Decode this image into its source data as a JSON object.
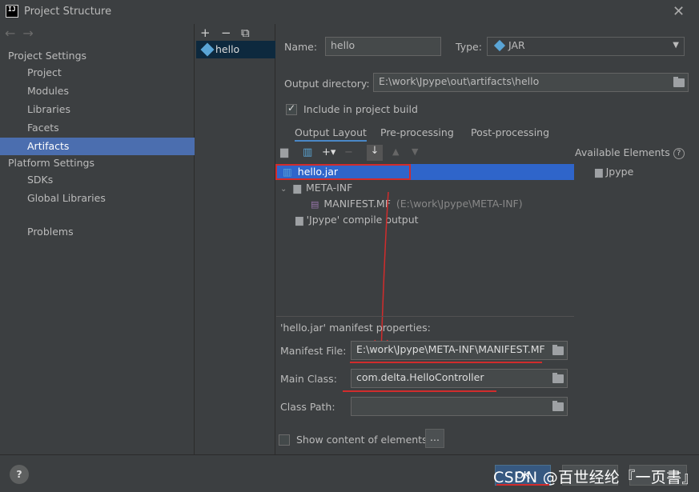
{
  "window": {
    "title": "Project Structure",
    "logo": "IJ"
  },
  "nav": {
    "back": "←",
    "forward": "→"
  },
  "sidebar": {
    "section1": "Project Settings",
    "items1": [
      "Project",
      "Modules",
      "Libraries",
      "Facets",
      "Artifacts"
    ],
    "section2": "Platform Settings",
    "items2": [
      "SDKs",
      "Global Libraries"
    ],
    "problems": "Problems",
    "selected": "Artifacts"
  },
  "artifacts": {
    "toolbar": [
      "+",
      "−",
      "⧉"
    ],
    "list": [
      "hello"
    ]
  },
  "form": {
    "name_label": "Name:",
    "name_value": "hello",
    "type_label": "Type:",
    "type_value": "JAR",
    "output_label": "Output directory:",
    "output_value": "E:\\work\\Jpype\\out\\artifacts\\hello",
    "include_label": "Include in project build",
    "include_checked": true
  },
  "tabs": [
    "Output Layout",
    "Pre-processing",
    "Post-processing"
  ],
  "tree": {
    "root": "hello.jar",
    "meta": "META-INF",
    "manifest": "MANIFEST.MF",
    "manifest_path": "(E:\\work\\Jpype\\META-INF)",
    "compile": "'Jpype' compile output"
  },
  "available": {
    "label": "Available Elements",
    "items": [
      "Jpype"
    ]
  },
  "manifest": {
    "heading": "'hello.jar' manifest properties:",
    "file_label": "Manifest File:",
    "file_value": "E:\\work\\Jpype\\META-INF\\MANIFEST.MF",
    "class_label": "Main Class:",
    "class_value": "com.delta.HelloController",
    "classpath_label": "Class Path:",
    "classpath_value": ""
  },
  "show_content": {
    "label": "Show content of elements",
    "button": "..."
  },
  "footer": {
    "help": "?",
    "ok": "OK",
    "cancel": "",
    "apply": ""
  },
  "watermark": "CSDN @百世经纶『一页書』",
  "colors": {
    "accent": "#4b6eaf",
    "selected_row": "#2f65ca",
    "annotation": "#d12c2c"
  }
}
